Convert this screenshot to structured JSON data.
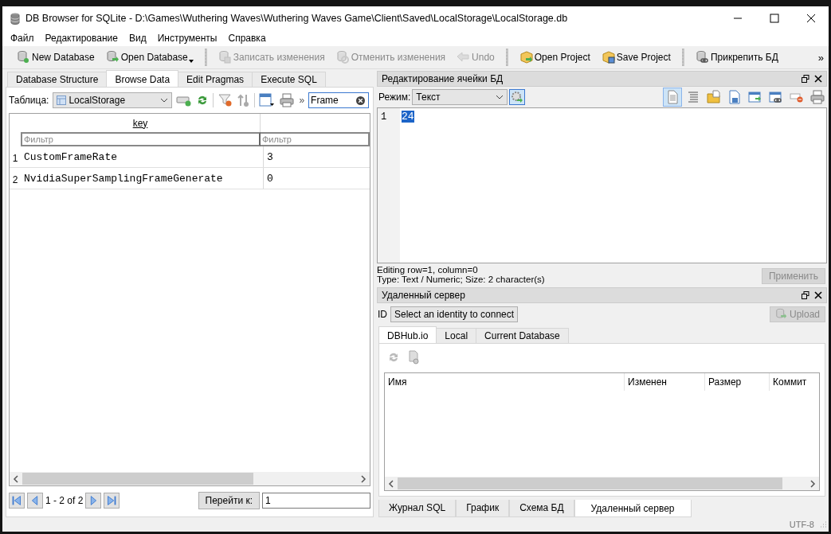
{
  "window": {
    "title": "DB Browser for SQLite - D:\\Games\\Wuthering Waves\\Wuthering Waves Game\\Client\\Saved\\LocalStorage\\LocalStorage.db"
  },
  "menu": [
    "Файл",
    "Редактирование",
    "Вид",
    "Инструменты",
    "Справка"
  ],
  "toolbar": [
    [
      {
        "label": "New Database",
        "kind": "new-db",
        "disabled": false,
        "dropdown": false
      },
      {
        "label": "Open Database",
        "kind": "open-db",
        "disabled": false,
        "dropdown": true
      }
    ],
    [
      {
        "label": "Записать изменения",
        "kind": "write",
        "disabled": true,
        "dropdown": false
      },
      {
        "label": "Отменить изменения",
        "kind": "revert",
        "disabled": true,
        "dropdown": false
      },
      {
        "label": "Undo",
        "kind": "undo",
        "disabled": true,
        "dropdown": false
      }
    ],
    [
      {
        "label": "Open Project",
        "kind": "open-project",
        "disabled": false,
        "dropdown": false
      },
      {
        "label": "Save Project",
        "kind": "save-project",
        "disabled": false,
        "dropdown": false
      }
    ],
    [
      {
        "label": "Прикрепить БД",
        "kind": "attach",
        "disabled": false,
        "dropdown": false
      }
    ]
  ],
  "toolbar_overflow": "»",
  "left_tabs": [
    {
      "label": "Database Structure",
      "selected": false
    },
    {
      "label": "Browse Data",
      "selected": true
    },
    {
      "label": "Edit Pragmas",
      "selected": false
    },
    {
      "label": "Execute SQL",
      "selected": false
    }
  ],
  "browse": {
    "table_label": "Таблица:",
    "table_select": "LocalStorage",
    "more": "»",
    "filter_value": "Frame",
    "columns": [
      "key"
    ],
    "filters": [
      {
        "placeholder": "Фильтр"
      },
      {
        "placeholder": "Фильтр"
      }
    ],
    "rows": [
      {
        "number": "1",
        "cells": [
          "CustomFrameRate",
          "3"
        ]
      },
      {
        "number": "2",
        "cells": [
          "NvidiaSuperSamplingFrameGenerate",
          "0"
        ]
      }
    ],
    "range": "1 - 2 of 2",
    "goto_label": "Перейти к:",
    "goto_value": "1"
  },
  "cell_editor": {
    "title": "Редактирование ячейки БД",
    "mode_label": "Режим:",
    "mode": "Текст",
    "tools": [
      {
        "kind": "text",
        "selected": true
      },
      {
        "kind": "indent",
        "selected": false
      },
      {
        "kind": "import",
        "selected": false
      },
      {
        "kind": "export",
        "selected": false
      },
      {
        "kind": "set-null",
        "selected": false
      },
      {
        "kind": "link",
        "selected": false
      },
      {
        "kind": "null",
        "selected": false
      },
      {
        "kind": "print",
        "selected": false
      }
    ],
    "line_number": "1",
    "content": "24",
    "content_selected": true,
    "info": [
      "Editing row=1, column=0",
      "Type: Text / Numeric; Size: 2 character(s)"
    ],
    "apply": {
      "label": "Применить",
      "disabled": true
    }
  },
  "remote": {
    "title": "Удаленный сервер",
    "id_label": "ID",
    "identity_select": "Select an identity to connect",
    "upload": {
      "label": "Upload",
      "disabled": true
    },
    "tabs": [
      {
        "label": "DBHub.io",
        "selected": true
      },
      {
        "label": "Local",
        "selected": false
      },
      {
        "label": "Current Database",
        "selected": false
      }
    ],
    "columns": [
      "Имя",
      "Изменен",
      "Размер",
      "Коммит"
    ]
  },
  "bottom_tabs": [
    {
      "label": "Журнал SQL",
      "selected": false
    },
    {
      "label": "График",
      "selected": false
    },
    {
      "label": "Схема БД",
      "selected": false
    },
    {
      "label": "Удаленный сервер",
      "selected": true
    }
  ],
  "status": {
    "encoding": "UTF-8"
  }
}
